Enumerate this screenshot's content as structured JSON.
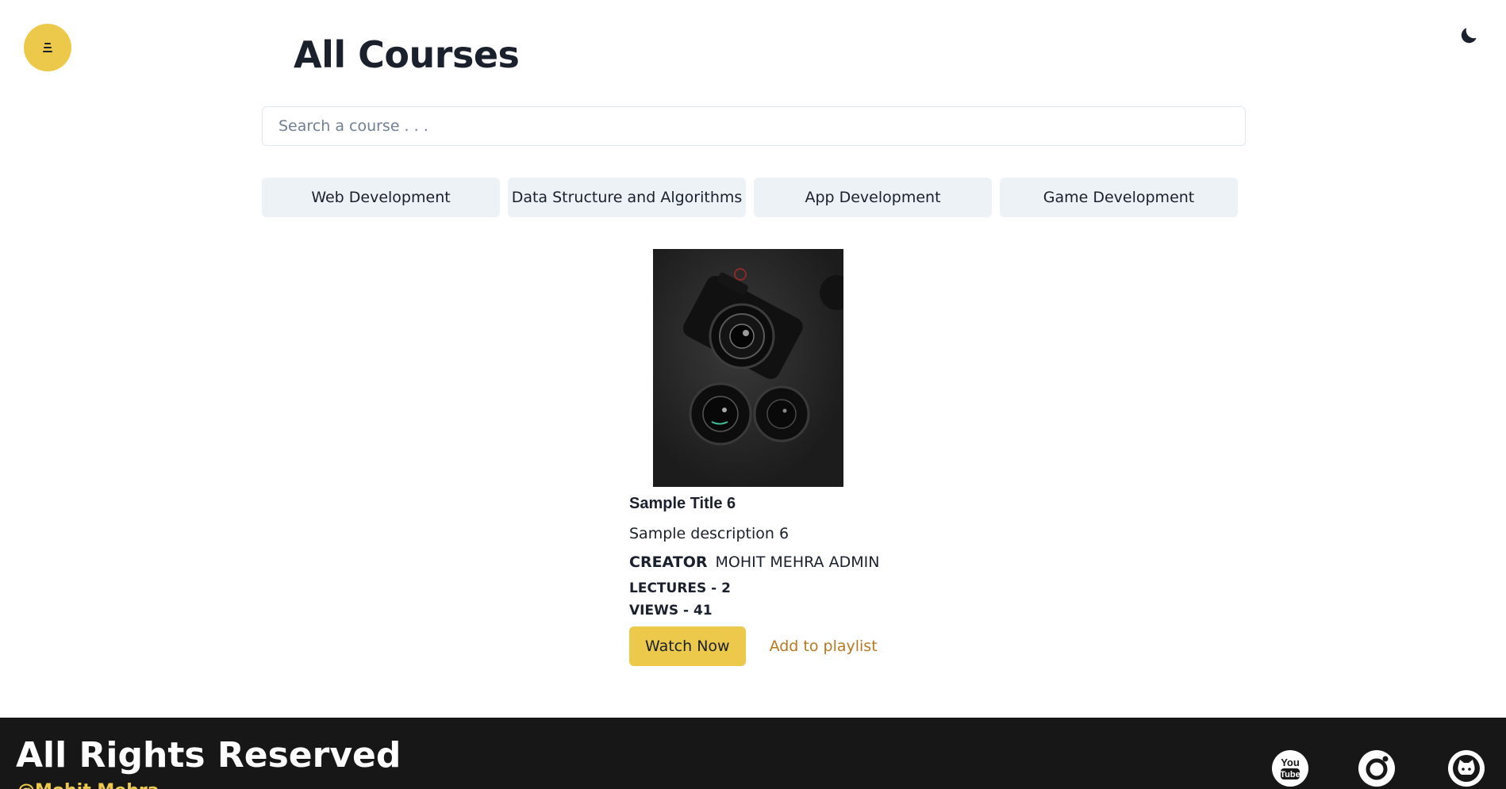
{
  "header": {
    "title": "All Courses",
    "menu_icon": "menu-icon",
    "theme_icon": "moon-icon"
  },
  "search": {
    "placeholder": "Search a course . . .",
    "value": ""
  },
  "categories": [
    {
      "label": "Web Development"
    },
    {
      "label": "Data Structure and Algorithms"
    },
    {
      "label": "App Development"
    },
    {
      "label": "Game Development"
    }
  ],
  "course": {
    "image": "camera-lenses-photo",
    "title": "Sample Title 6",
    "description": "Sample description 6",
    "creator_label": "CREATOR",
    "creator_name": "MOHIT MEHRA ADMIN",
    "lectures": "LECTURES - 2",
    "views": "VIEWS - 41",
    "watch_label": "Watch Now",
    "playlist_label": "Add to playlist"
  },
  "footer": {
    "title": "All Rights Reserved",
    "subtitle": "@Mohit Mehra",
    "social": [
      {
        "icon": "youtube-icon"
      },
      {
        "icon": "instagram-icon"
      },
      {
        "icon": "github-icon"
      }
    ]
  },
  "colors": {
    "accent": "#ecc94b",
    "link": "#b7791f",
    "footer_bg": "#171717",
    "category_bg": "#edf2f7"
  }
}
